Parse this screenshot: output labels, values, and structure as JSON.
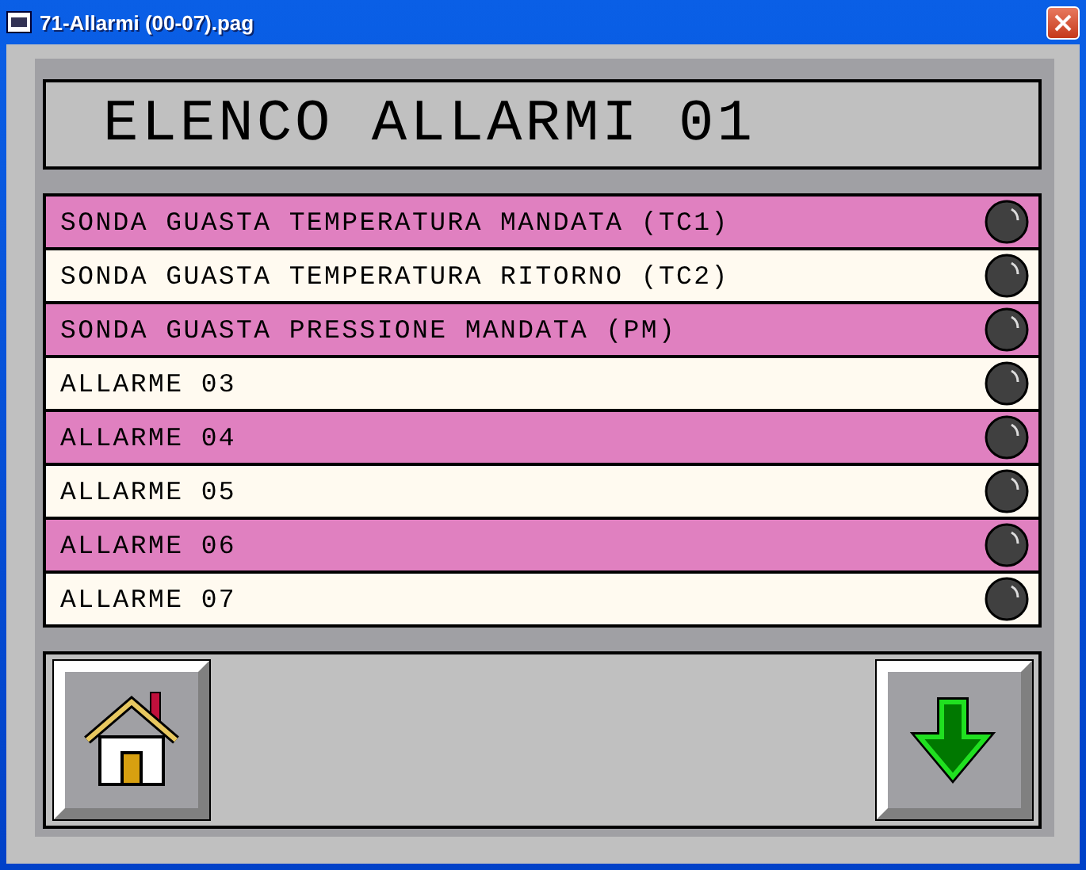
{
  "window": {
    "title": "71-Allarmi (00-07).pag"
  },
  "header": {
    "title": "ELENCO ALLARMI 01"
  },
  "alarms": [
    {
      "label": "SONDA GUASTA TEMPERATURA MANDATA (TC1)",
      "color": "#e080c0",
      "active": false
    },
    {
      "label": "SONDA GUASTA TEMPERATURA RITORNO (TC2)",
      "color": "#fffaf0",
      "active": false
    },
    {
      "label": "SONDA GUASTA PRESSIONE MANDATA (PM)",
      "color": "#e080c0",
      "active": false
    },
    {
      "label": "ALLARME 03",
      "color": "#fffaf0",
      "active": false
    },
    {
      "label": "ALLARME 04",
      "color": "#e080c0",
      "active": false
    },
    {
      "label": "ALLARME 05",
      "color": "#fffaf0",
      "active": false
    },
    {
      "label": "ALLARME 06",
      "color": "#e080c0",
      "active": false
    },
    {
      "label": "ALLARME 07",
      "color": "#fffaf0",
      "active": false
    }
  ]
}
